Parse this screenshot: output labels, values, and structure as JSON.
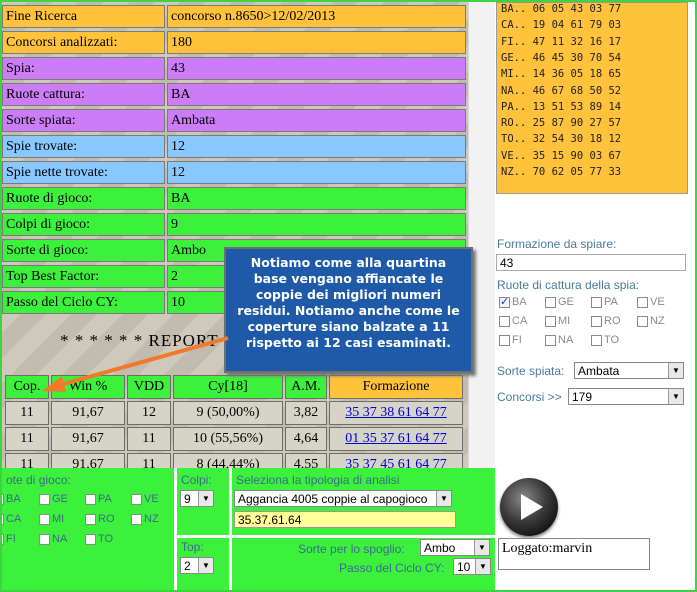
{
  "summary_rows": [
    {
      "label": "Fine Ricerca",
      "value": "concorso n.8650>12/02/2013",
      "color": "orange"
    },
    {
      "label": "Concorsi analizzati:",
      "value": "180",
      "color": "orange"
    },
    {
      "label": "Spia:",
      "value": "43",
      "color": "purple"
    },
    {
      "label": "Ruote cattura:",
      "value": "BA",
      "color": "purple"
    },
    {
      "label": "Sorte spiata:",
      "value": "Ambata",
      "color": "purple"
    },
    {
      "label": "Spie trovate:",
      "value": "12",
      "color": "blue"
    },
    {
      "label": "Spie nette trovate:",
      "value": "12",
      "color": "blue"
    },
    {
      "label": "Ruote di gioco:",
      "value": "BA",
      "color": "green"
    },
    {
      "label": "Colpi di gioco:",
      "value": "9",
      "color": "green"
    },
    {
      "label": "Sorte di gioco:",
      "value": "Ambo",
      "color": "green"
    },
    {
      "label": "Top Best Factor:",
      "value": "2",
      "color": "green"
    },
    {
      "label": "Passo del Ciclo CY:",
      "value": "10",
      "color": "green"
    }
  ],
  "report_title": "* * * * * * REPORT",
  "table": {
    "headers": [
      "Cop.",
      "Win %",
      "VDD",
      "Cy[18]",
      "A.M.",
      "Formazione"
    ],
    "rows": [
      [
        "11",
        "91,67",
        "12",
        "9 (50,00%)",
        "3,82",
        "35 37 38 61 64 77"
      ],
      [
        "11",
        "91,67",
        "11",
        "10 (55,56%)",
        "4,64",
        "01 35 37 61 64 77"
      ],
      [
        "11",
        "91,67",
        "11",
        "8 (44,44%)",
        "4,55",
        "35 37 45 61 64 77"
      ]
    ]
  },
  "callout_text": "Notiamo come alla quartina base vengano affiancate le coppie dei migliori numeri residui. Notiamo anche come le coperture siano balzate a 11 rispetto ai 12 casi esaminati.",
  "right_panel": {
    "wheel_lines": [
      "BA.. 06 05 43 03 77",
      "CA.. 19 04 61 79 03",
      "FI.. 47 11 32 16 17",
      "GE.. 46 45 30 70 54",
      "MI.. 14 36 05 18 65",
      "NA.. 46 67 68 50 52",
      "PA.. 13 51 53 89 14",
      "RO.. 25 87 90 27 57",
      "TO.. 32 54 30 18 12",
      "VE.. 35 15 90 03 67",
      "NZ.. 70 62 05 77 33"
    ],
    "formazione_label": "Formazione da spiare:",
    "formazione_value": "43",
    "ruote_label": "Ruote di cattura della spia:",
    "ruote": [
      {
        "name": "BA",
        "checked": true
      },
      {
        "name": "GE",
        "checked": false
      },
      {
        "name": "PA",
        "checked": false
      },
      {
        "name": "VE",
        "checked": false
      },
      {
        "name": "CA",
        "checked": false
      },
      {
        "name": "MI",
        "checked": false
      },
      {
        "name": "RO",
        "checked": false
      },
      {
        "name": "NZ",
        "checked": false
      },
      {
        "name": "FI",
        "checked": false
      },
      {
        "name": "NA",
        "checked": false
      },
      {
        "name": "TO",
        "checked": false
      }
    ],
    "sorte_label": "Sorte spiata:",
    "sorte_value": "Ambata",
    "concorsi_label": "Concorsi >>",
    "concorsi_value": "179"
  },
  "bottom": {
    "ruote_label": "ote di gioco:",
    "ruote": [
      {
        "name": "BA",
        "checked": false
      },
      {
        "name": "GE",
        "checked": false
      },
      {
        "name": "PA",
        "checked": false
      },
      {
        "name": "VE",
        "checked": false
      },
      {
        "name": "CA",
        "checked": false
      },
      {
        "name": "MI",
        "checked": false
      },
      {
        "name": "RO",
        "checked": false
      },
      {
        "name": "NZ",
        "checked": false
      },
      {
        "name": "FI",
        "checked": false
      },
      {
        "name": "NA",
        "checked": false
      },
      {
        "name": "TO",
        "checked": false
      }
    ],
    "colpi_label": "Colpi:",
    "colpi_value": "9",
    "top_label": "Top:",
    "top_value": "2",
    "analisi_label": "Seleziona la tipologia di analisi",
    "analisi_value": "Aggancia 4005 coppie al capogioco",
    "capogioco_value": "35.37.61.64",
    "sorte_spoglio_label": "Sorte per lo spoglio:",
    "sorte_spoglio_value": "Ambo",
    "passo_label": "Passo del Ciclo CY:",
    "passo_value": "10",
    "login_text": "Loggato:marvin"
  },
  "colors": {
    "orange": "#ffc23a",
    "purple": "#cc7cf7",
    "blue": "#88c8ff",
    "green": "#3cf13c",
    "callout": "#1e5aa8",
    "arrow": "#f07a2a"
  }
}
